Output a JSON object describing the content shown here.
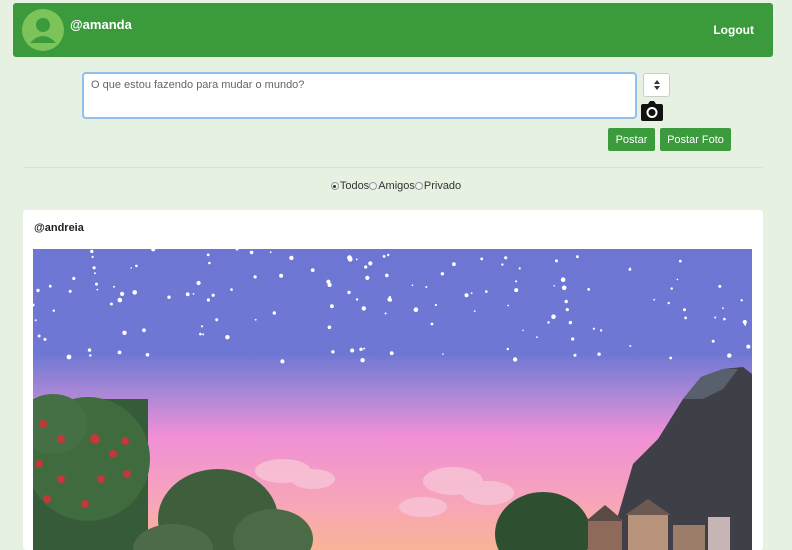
{
  "header": {
    "username": "@amanda",
    "logout_label": "Logout"
  },
  "composer": {
    "placeholder": "O que estou fazendo para mudar o mundo?",
    "post_label": "Postar",
    "post_photo_label": "Postar Foto"
  },
  "filters": [
    {
      "label": "Todos",
      "checked": true
    },
    {
      "label": "Amigos",
      "checked": false
    },
    {
      "label": "Privado",
      "checked": false
    }
  ],
  "feed": {
    "posts": [
      {
        "author": "@andreia"
      }
    ]
  },
  "colors": {
    "accent": "#3a9a3c",
    "background": "#e6f1e2"
  }
}
